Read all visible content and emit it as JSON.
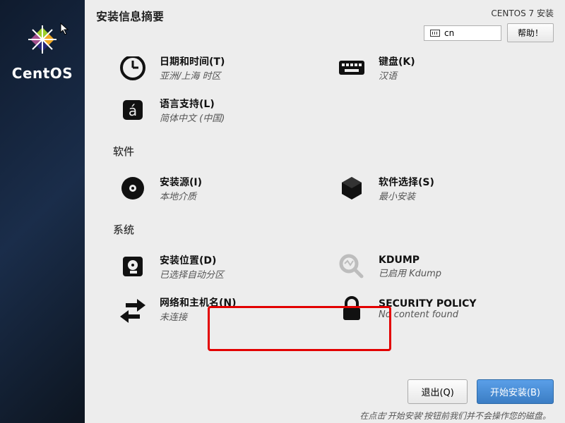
{
  "brand": "CentOS",
  "header": {
    "title": "安装信息摘要",
    "subtitle": "CENTOS 7 安装",
    "lang_code": "cn",
    "help_label": "帮助！"
  },
  "sections": {
    "localization": {
      "datetime": {
        "title": "日期和时间(T)",
        "status": "亚洲/上海 时区"
      },
      "keyboard": {
        "title": "键盘(K)",
        "status": "汉语"
      },
      "language": {
        "title": "语言支持(L)",
        "status": "简体中文 (中国)"
      }
    },
    "software_label": "软件",
    "software": {
      "source": {
        "title": "安装源(I)",
        "status": "本地介质"
      },
      "selection": {
        "title": "软件选择(S)",
        "status": "最小安装"
      }
    },
    "system_label": "系统",
    "system": {
      "destination": {
        "title": "安装位置(D)",
        "status": "已选择自动分区"
      },
      "kdump": {
        "title": "KDUMP",
        "status": "已启用 Kdump"
      },
      "network": {
        "title": "网络和主机名(N)",
        "status": "未连接"
      },
      "security": {
        "title": "SECURITY POLICY",
        "status": "No content found"
      }
    }
  },
  "footer": {
    "quit": "退出(Q)",
    "begin": "开始安装(B)",
    "hint": "在点击'开始安装'按钮前我们并不会操作您的磁盘。"
  }
}
